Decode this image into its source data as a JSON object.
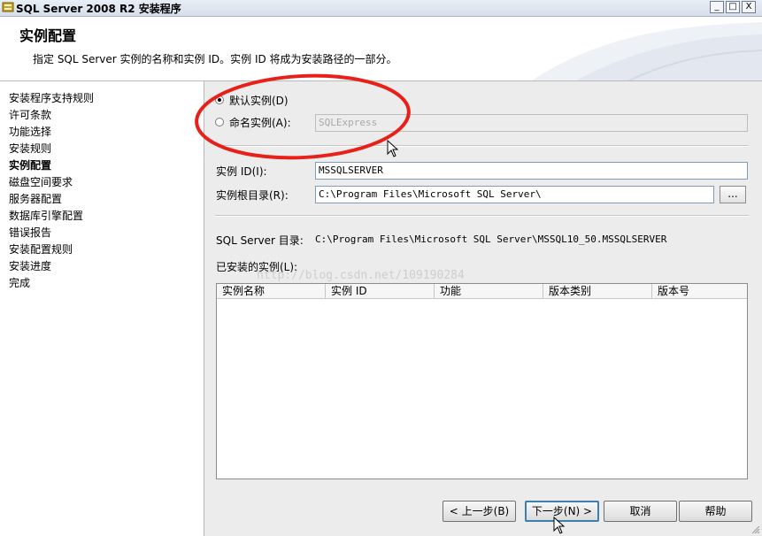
{
  "window": {
    "title": "SQL Server 2008 R2 安装程序",
    "controls": {
      "minimize": "_",
      "maximize": "□",
      "close": "X"
    }
  },
  "header": {
    "title": "实例配置",
    "description": "指定 SQL Server 实例的名称和实例 ID。实例 ID 将成为安装路径的一部分。"
  },
  "nav": {
    "items": [
      {
        "label": "安装程序支持规则",
        "active": false
      },
      {
        "label": "许可条款",
        "active": false
      },
      {
        "label": "功能选择",
        "active": false
      },
      {
        "label": "安装规则",
        "active": false
      },
      {
        "label": "实例配置",
        "active": true
      },
      {
        "label": "磁盘空间要求",
        "active": false
      },
      {
        "label": "服务器配置",
        "active": false
      },
      {
        "label": "数据库引擎配置",
        "active": false
      },
      {
        "label": "错误报告",
        "active": false
      },
      {
        "label": "安装配置规则",
        "active": false
      },
      {
        "label": "安装进度",
        "active": false
      },
      {
        "label": "完成",
        "active": false
      }
    ]
  },
  "instance": {
    "default_instance_label": "默认实例(D)",
    "named_instance_label": "命名实例(A):",
    "named_instance_value": "SQLExpress",
    "selected": "default"
  },
  "fields": {
    "instance_id_label": "实例 ID(I):",
    "instance_id_value": "MSSQLSERVER",
    "root_dir_label": "实例根目录(R):",
    "root_dir_value": "C:\\Program Files\\Microsoft SQL Server\\",
    "browse_label": "..."
  },
  "directory": {
    "label": "SQL Server 目录:",
    "value": "C:\\Program Files\\Microsoft SQL Server\\MSSQL10_50.MSSQLSERVER"
  },
  "installed": {
    "label": "已安装的实例(L):",
    "columns": [
      "实例名称",
      "实例 ID",
      "功能",
      "版本类别",
      "版本号"
    ],
    "rows": []
  },
  "watermark": "http://blog.csdn.net/109190284",
  "buttons": {
    "back": "< 上一步(B)",
    "next": "下一步(N) >",
    "cancel": "取消",
    "help": "帮助"
  },
  "colors": {
    "annotation": "#e8201a",
    "content_bg": "#ececec"
  }
}
